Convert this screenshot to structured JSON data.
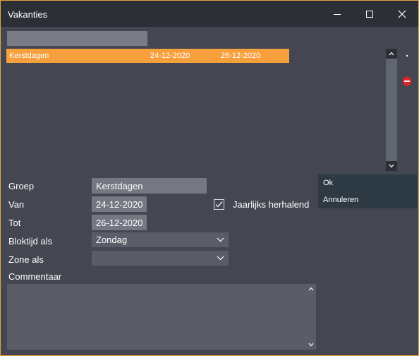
{
  "window": {
    "title": "Vakanties",
    "accent_color": "#e8a33a",
    "controls": [
      "minimize-icon",
      "maximize-icon",
      "close-icon"
    ]
  },
  "search": {
    "value": "",
    "placeholder": ""
  },
  "holidays": {
    "rows": [
      {
        "name": "Kerstdagen",
        "from": "24-12-2020",
        "to": "26-12-2020",
        "selected": true
      }
    ],
    "selection_color": "#f5a03c",
    "side_icons": [
      "dot-icon",
      "remove-icon"
    ]
  },
  "form": {
    "groep_label": "Groep",
    "groep_value": "Kerstdagen",
    "van_label": "Van",
    "van_value": "24-12-2020",
    "tot_label": "Tot",
    "tot_value": "26-12-2020",
    "bloktijd_label": "Bloktijd als",
    "bloktijd_value": "Zondag",
    "zone_label": "Zone als",
    "zone_value": "",
    "jaarlijks_label": "Jaarlijks herhalend",
    "jaarlijks_checked": true,
    "commentaar_label": "Commentaar",
    "commentaar_value": ""
  },
  "buttons": {
    "ok_label": "Ok",
    "cancel_label": "Annuleren"
  }
}
